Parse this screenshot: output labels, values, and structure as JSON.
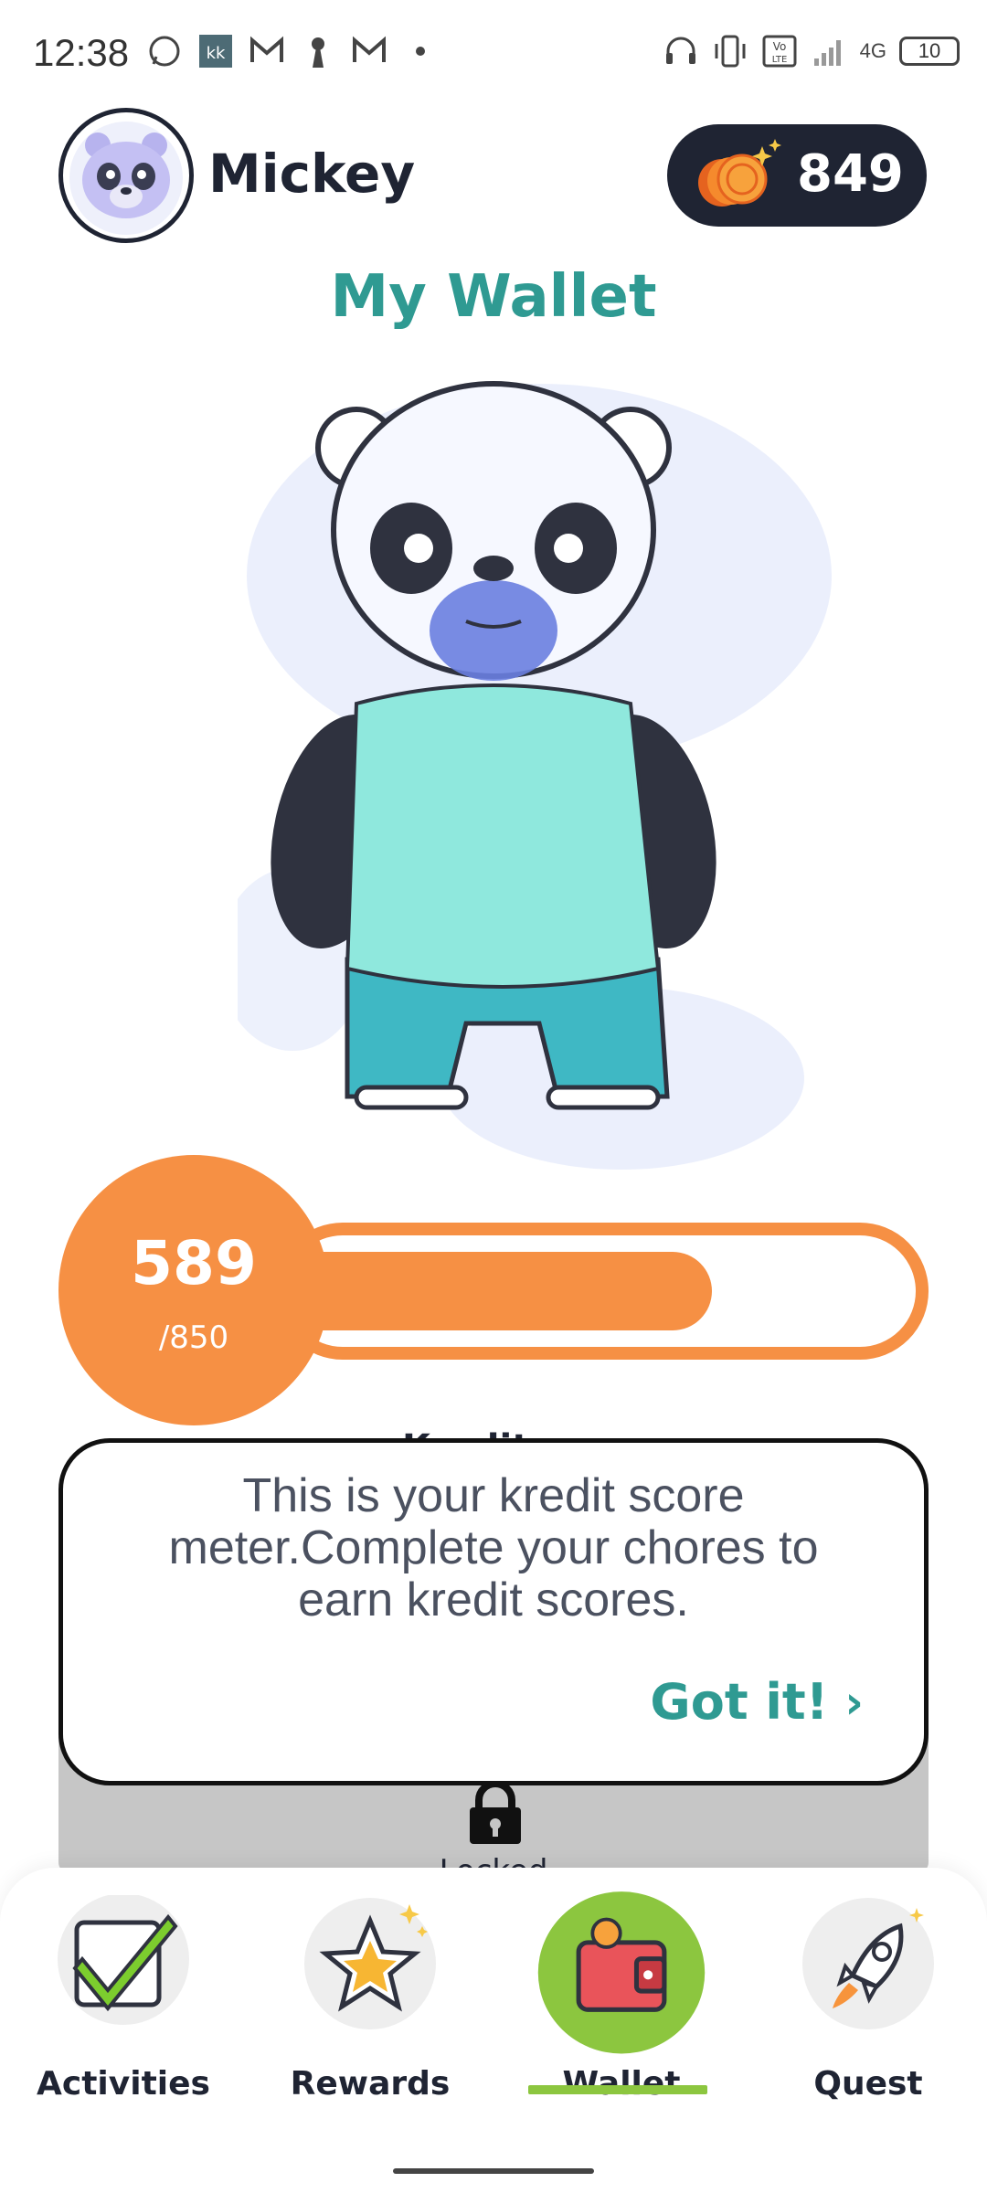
{
  "status_bar": {
    "time": "12:38",
    "battery": "10",
    "network": "4G",
    "left_icons": [
      "whatsapp-icon",
      "kk-app-icon",
      "gmail-icon",
      "keyhole-icon",
      "gmail-icon",
      "dot-icon"
    ],
    "right_icons": [
      "headset-icon",
      "vibrate-icon",
      "volte-icon",
      "signal-icon",
      "battery-icon"
    ]
  },
  "header": {
    "username": "Mickey",
    "coins": "849"
  },
  "page_title": "My Wallet",
  "score": {
    "value": "589",
    "max_label": "/850",
    "progress": 0.69,
    "color": "#f69044"
  },
  "hidden_section_title": "Kredit",
  "locked_label": "Locked",
  "tooltip": {
    "text": "This is your kredit score meter.Complete your chores to earn kredit scores.",
    "button_label": "Got it!",
    "button_chevron": "›"
  },
  "nav": {
    "items": [
      {
        "label": "Activities",
        "icon": "checkmark-icon"
      },
      {
        "label": "Rewards",
        "icon": "star-icon"
      },
      {
        "label": "Wallet",
        "icon": "wallet-icon",
        "active": true
      },
      {
        "label": "Quest",
        "icon": "rocket-icon"
      }
    ]
  },
  "colors": {
    "accent_teal": "#2f9a92",
    "meter_orange": "#f69044",
    "dark": "#1f2433",
    "active_green": "#8cc63f"
  }
}
